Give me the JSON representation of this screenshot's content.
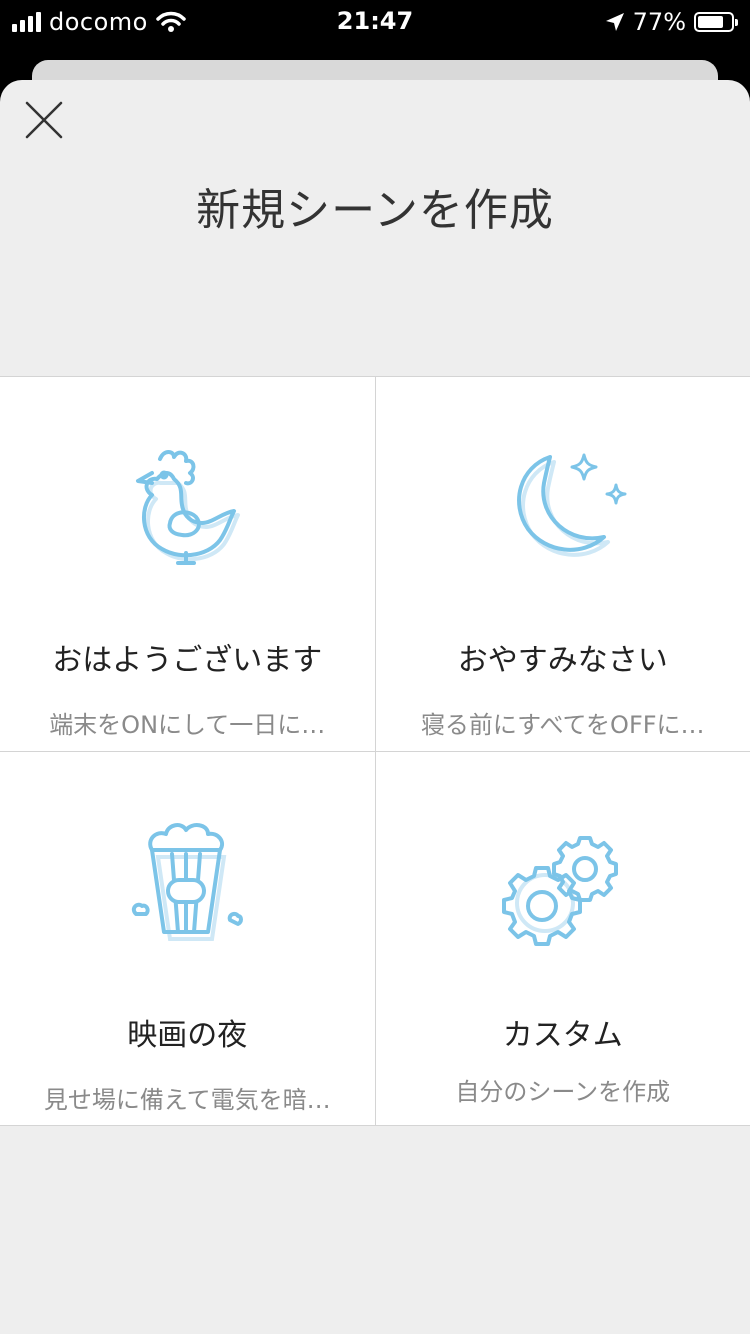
{
  "status_bar": {
    "carrier": "docomo",
    "time": "21:47",
    "battery_text": "77%",
    "battery_level": 0.77
  },
  "sheet": {
    "title": "新規シーンを作成",
    "close_icon": "close-icon"
  },
  "scenes": [
    {
      "icon": "rooster-icon",
      "name": "おはようございます",
      "description": "端末をONにして一日に…"
    },
    {
      "icon": "moon-stars-icon",
      "name": "おやすみなさい",
      "description": "寝る前にすべてをOFFに…"
    },
    {
      "icon": "popcorn-icon",
      "name": "映画の夜",
      "description": "見せ場に備えて電気を暗…"
    },
    {
      "icon": "gears-icon",
      "name": "カスタム",
      "description": "自分のシーンを作成"
    }
  ],
  "colors": {
    "icon_stroke": "#7cc4e8",
    "icon_shadow": "#cfe8f6",
    "sheet_bg": "#eeeeee"
  }
}
